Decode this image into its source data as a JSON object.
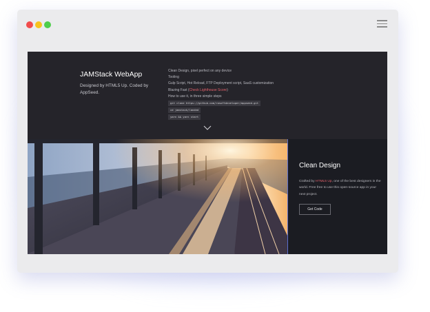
{
  "hero": {
    "title": "JAMStack WebApp",
    "subtitle": "Designed by HTML5 Up. Coded by AppSeed.",
    "features": [
      "Clean Design, pixel perfect on any device",
      "Tooling",
      "Gulp Script, Hot Reload, FTP Deployment script, SaaS customization"
    ],
    "blazing_prefix": "Blazing Fast (",
    "blazing_link": "Check Lighthouse Score",
    "blazing_suffix": ")",
    "howto": "How to use it, in three simple steps",
    "commands": [
      "git clone https://github.com/rosoftdeveloper/appseed.git",
      "cd jamstack/landed",
      "yarn && yarn start"
    ]
  },
  "side": {
    "title": "Clean Design",
    "text_prefix": "Crafted by ",
    "text_link": "HTML5 Up",
    "text_suffix": ", one of the best designers in the world. Free free to use this open-source app in your next project.",
    "button": "Get Code"
  },
  "icons": {
    "menu": "hamburger-menu-icon",
    "scroll": "chevron-down-icon"
  },
  "colors": {
    "accent": "#e3616b",
    "border_accent": "#5a6fd0"
  }
}
